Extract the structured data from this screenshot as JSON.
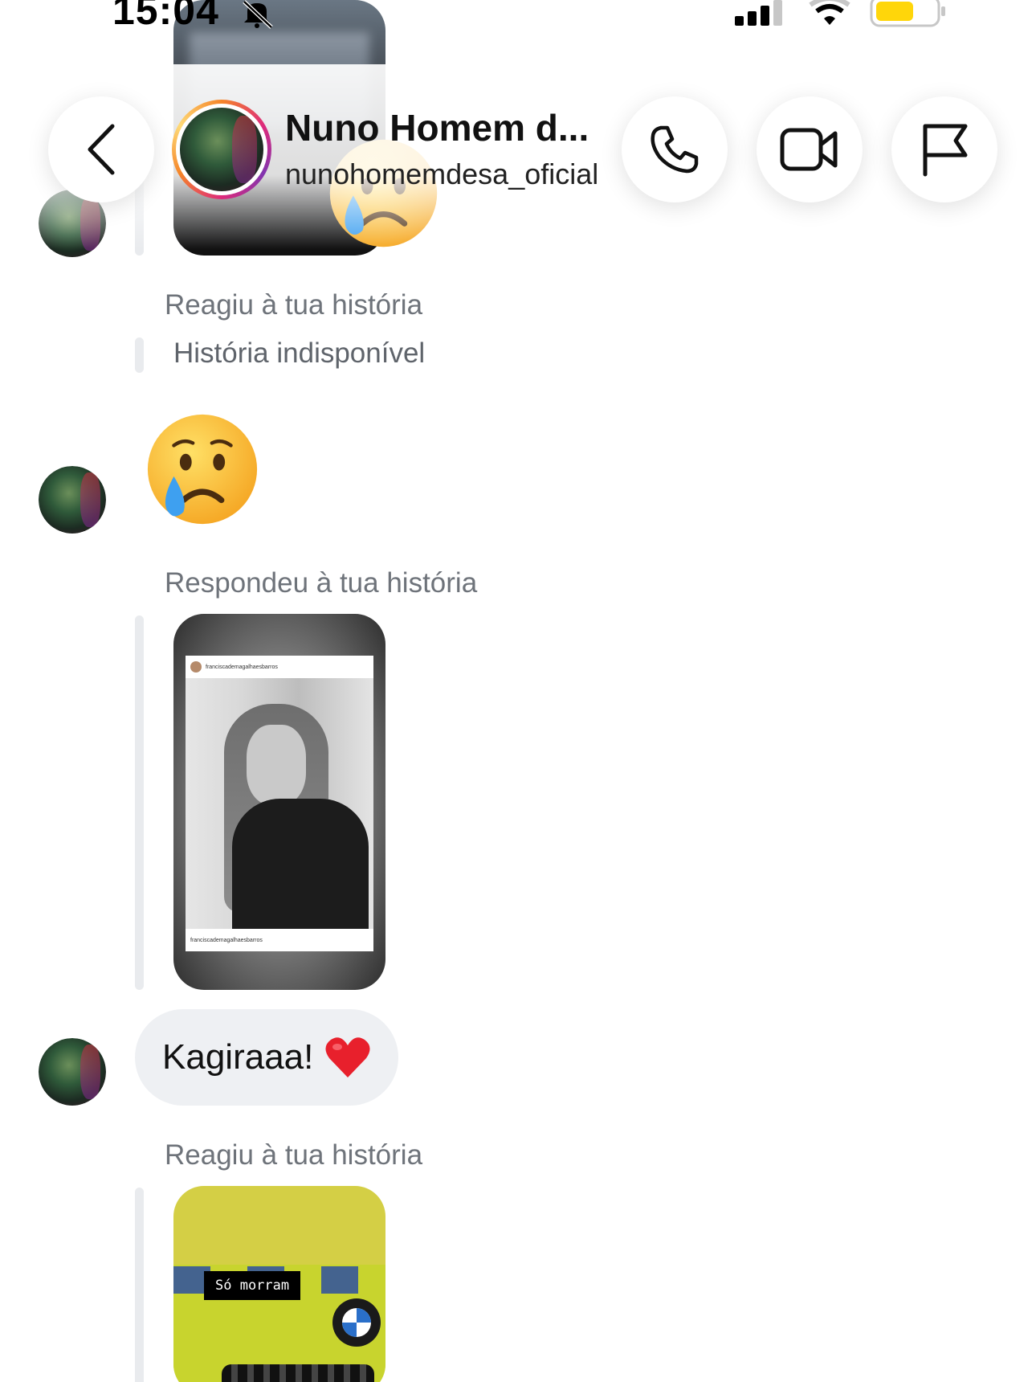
{
  "status_bar": {
    "time": "15:04",
    "icons": [
      "bell-off-icon",
      "signal-icon",
      "wifi-icon",
      "battery-icon"
    ]
  },
  "header": {
    "contact_name": "Nuno Homem d...",
    "username": "nunohomemdesa_oficial",
    "buttons": [
      "back-icon",
      "phone-icon",
      "video-camera-icon",
      "flag-icon"
    ]
  },
  "messages": {
    "story1_label": "Reagiu à tua história",
    "story1_unavailable": "História indisponível",
    "story2_label": "Respondeu à tua história",
    "story2_card_user": "franciscademagalhaesbarros",
    "story2_card_caption": "franciscademagalhaesbarros",
    "text_message": "Kagiraaa!",
    "story3_label": "Reagiu à tua história",
    "story3_caption": "Só morram"
  },
  "colors": {
    "accent_ring": "#dd2a7b",
    "bubble_bg": "#eef0f3",
    "meta_text": "#6e737a"
  }
}
